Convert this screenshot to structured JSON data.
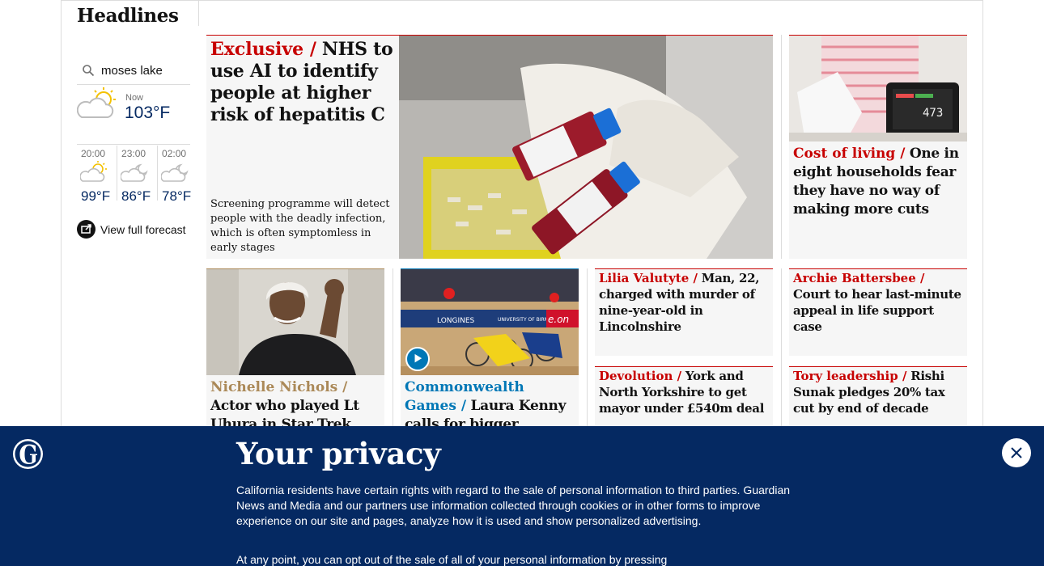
{
  "section": {
    "title": "Headlines"
  },
  "weather": {
    "search_value": "moses lake",
    "now_label": "Now",
    "now_temp": "103°F",
    "hours": [
      {
        "time": "20:00",
        "temp": "99°F",
        "icon": "partly-sunny-icon"
      },
      {
        "time": "23:00",
        "temp": "86°F",
        "icon": "cloud-moon-icon"
      },
      {
        "time": "02:00",
        "temp": "78°F",
        "icon": "cloud-moon-icon"
      }
    ],
    "forecast_link": "View full forecast"
  },
  "lead": {
    "kicker": "Exclusive /",
    "headline": "NHS to use AI to identify people at higher risk of hepatitis C",
    "standfirst": "Screening programme will detect people with the deadly infection, which is often symptomless in early stages",
    "image": "blood-sample-vials-photo"
  },
  "cost_of_living": {
    "kicker": "Cost of living /",
    "headline": "One in eight households fear they have no way of making more cuts",
    "image": "kettle-energy-meter-photo"
  },
  "nichols": {
    "kicker": "Nichelle Nichols /",
    "headline": "Actor who played Lt Uhura in Star Trek dies",
    "image": "nichelle-nichols-photo"
  },
  "commonwealth": {
    "kicker": "Commonwealth Games /",
    "headline": "Laura Kenny calls for bigger barriers",
    "image": "cycling-crash-photo",
    "play_icon": "play-icon"
  },
  "lilia": {
    "kicker": "Lilia Valutyte /",
    "headline": "Man, 22, charged with murder of nine-year-old in Lincolnshire"
  },
  "archie": {
    "kicker": "Archie Battersbee /",
    "headline": "Court to hear last-minute appeal in life support case"
  },
  "devolution": {
    "kicker": "Devolution /",
    "headline": "York and North Yorkshire to get mayor under £540m deal"
  },
  "tory": {
    "kicker": "Tory leadership /",
    "headline": "Rishi Sunak pledges 20% tax cut by end of decade"
  },
  "privacy": {
    "title": "Your privacy",
    "body": "California residents have certain rights with regard to the sale of personal information to third parties. Guardian News and Media and our partners use information collected through cookies or in other forms to improve experience on our site and pages, analyze how it is used and show personalized advertising.",
    "body2": "At any point, you can opt out of the sale of all of your personal information by pressing",
    "close_icon": "close-icon",
    "logo": "guardian-g-logo"
  },
  "colors": {
    "brand_blue": "#052962",
    "news_red": "#c70000",
    "culture_brown": "#ab8958",
    "sport_blue": "#0077b6"
  }
}
